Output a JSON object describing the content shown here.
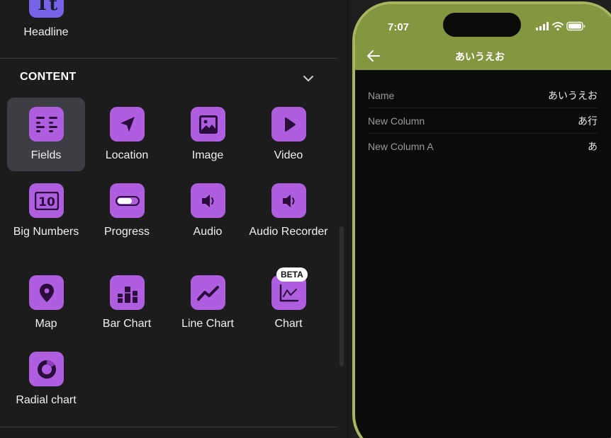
{
  "headline": {
    "label": "Headline",
    "glyph": "Tt"
  },
  "section": {
    "title": "CONTENT"
  },
  "components": [
    {
      "label": "Fields",
      "icon": "fields-icon",
      "selected": true
    },
    {
      "label": "Location",
      "icon": "location-arrow-icon"
    },
    {
      "label": "Image",
      "icon": "image-icon"
    },
    {
      "label": "Video",
      "icon": "play-icon"
    },
    {
      "label": "Big Numbers",
      "icon": "big-numbers-icon",
      "glyph": "10"
    },
    {
      "label": "Progress",
      "icon": "progress-icon"
    },
    {
      "label": "Audio",
      "icon": "speaker-icon"
    },
    {
      "label": "Audio Recorder",
      "icon": "speaker-icon"
    },
    {
      "label": "Map",
      "icon": "map-pin-icon"
    },
    {
      "label": "Bar Chart",
      "icon": "bar-chart-icon"
    },
    {
      "label": "Line Chart",
      "icon": "line-chart-icon"
    },
    {
      "label": "Chart",
      "icon": "chart-icon",
      "badge": "BETA"
    },
    {
      "label": "Radial chart",
      "icon": "radial-chart-icon"
    }
  ],
  "phone": {
    "time": "7:07",
    "title": "あいうえお",
    "accent": "#84963f",
    "rows": [
      {
        "label": "Name",
        "value": "あいうえお"
      },
      {
        "label": "New Column",
        "value": "あ行"
      },
      {
        "label": "New Column A",
        "value": "あ"
      }
    ]
  },
  "colors": {
    "icon_purple": "#b05ee0",
    "headline_purple": "#7763e6",
    "bezel": "#a7b55f"
  }
}
